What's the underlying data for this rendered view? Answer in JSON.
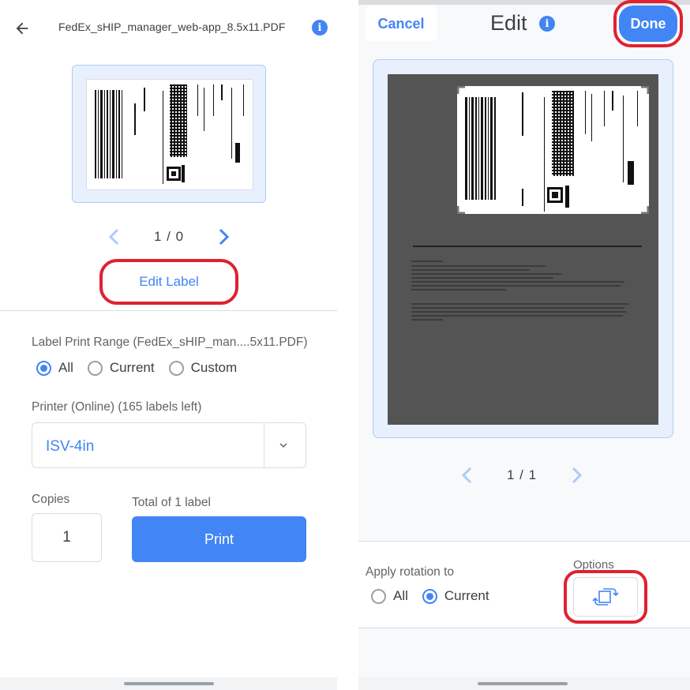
{
  "left": {
    "file_title": "FedEx_sHIP_manager_web-app_8.5x11.PDF",
    "info_icon": "info-icon",
    "pager": {
      "text": "1 / 0"
    },
    "edit_label": "Edit Label",
    "range_label": "Label Print Range (FedEx_sHIP_man....5x11.PDF)",
    "range_options": [
      {
        "label": "All",
        "selected": true
      },
      {
        "label": "Current",
        "selected": false
      },
      {
        "label": "Custom",
        "selected": false
      }
    ],
    "printer_label": "Printer (Online) (165 labels left)",
    "printer_value": "ISV-4in",
    "copies_label": "Copies",
    "copies_value": "1",
    "total_label": "Total of 1 label",
    "print_button": "Print"
  },
  "right": {
    "cancel": "Cancel",
    "title": "Edit",
    "done": "Done",
    "pager": {
      "text": "1 / 1"
    },
    "rotation_label": "Apply rotation to",
    "rotation_options": [
      {
        "label": "All",
        "selected": false
      },
      {
        "label": "Current",
        "selected": true
      }
    ],
    "options_label": "Options"
  },
  "colors": {
    "accent": "#4285f4",
    "highlight": "#e0212f",
    "preview_bg": "#545454"
  }
}
